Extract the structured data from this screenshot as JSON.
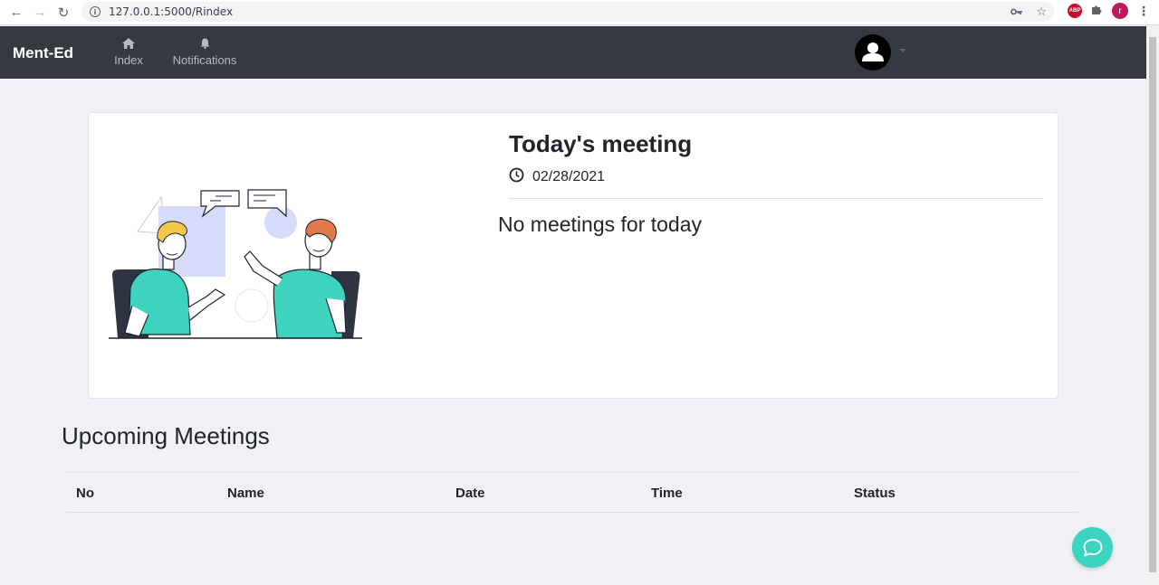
{
  "browser": {
    "url": "127.0.0.1:5000/Rindex",
    "profile_initial": "r",
    "extension_label": "ABP"
  },
  "navbar": {
    "brand": "Ment-Ed",
    "items": [
      {
        "label": "Index",
        "icon": "home-icon"
      },
      {
        "label": "Notifications",
        "icon": "bell-icon"
      }
    ]
  },
  "meeting_card": {
    "title": "Today's meeting",
    "date": "02/28/2021",
    "empty_message": "No meetings for today"
  },
  "upcoming": {
    "title": "Upcoming Meetings",
    "columns": [
      "No",
      "Name",
      "Date",
      "Time",
      "Status"
    ],
    "rows": []
  },
  "colors": {
    "navbar": "#343a40",
    "accent": "#3bd4c1",
    "background": "#f0f1f4"
  }
}
